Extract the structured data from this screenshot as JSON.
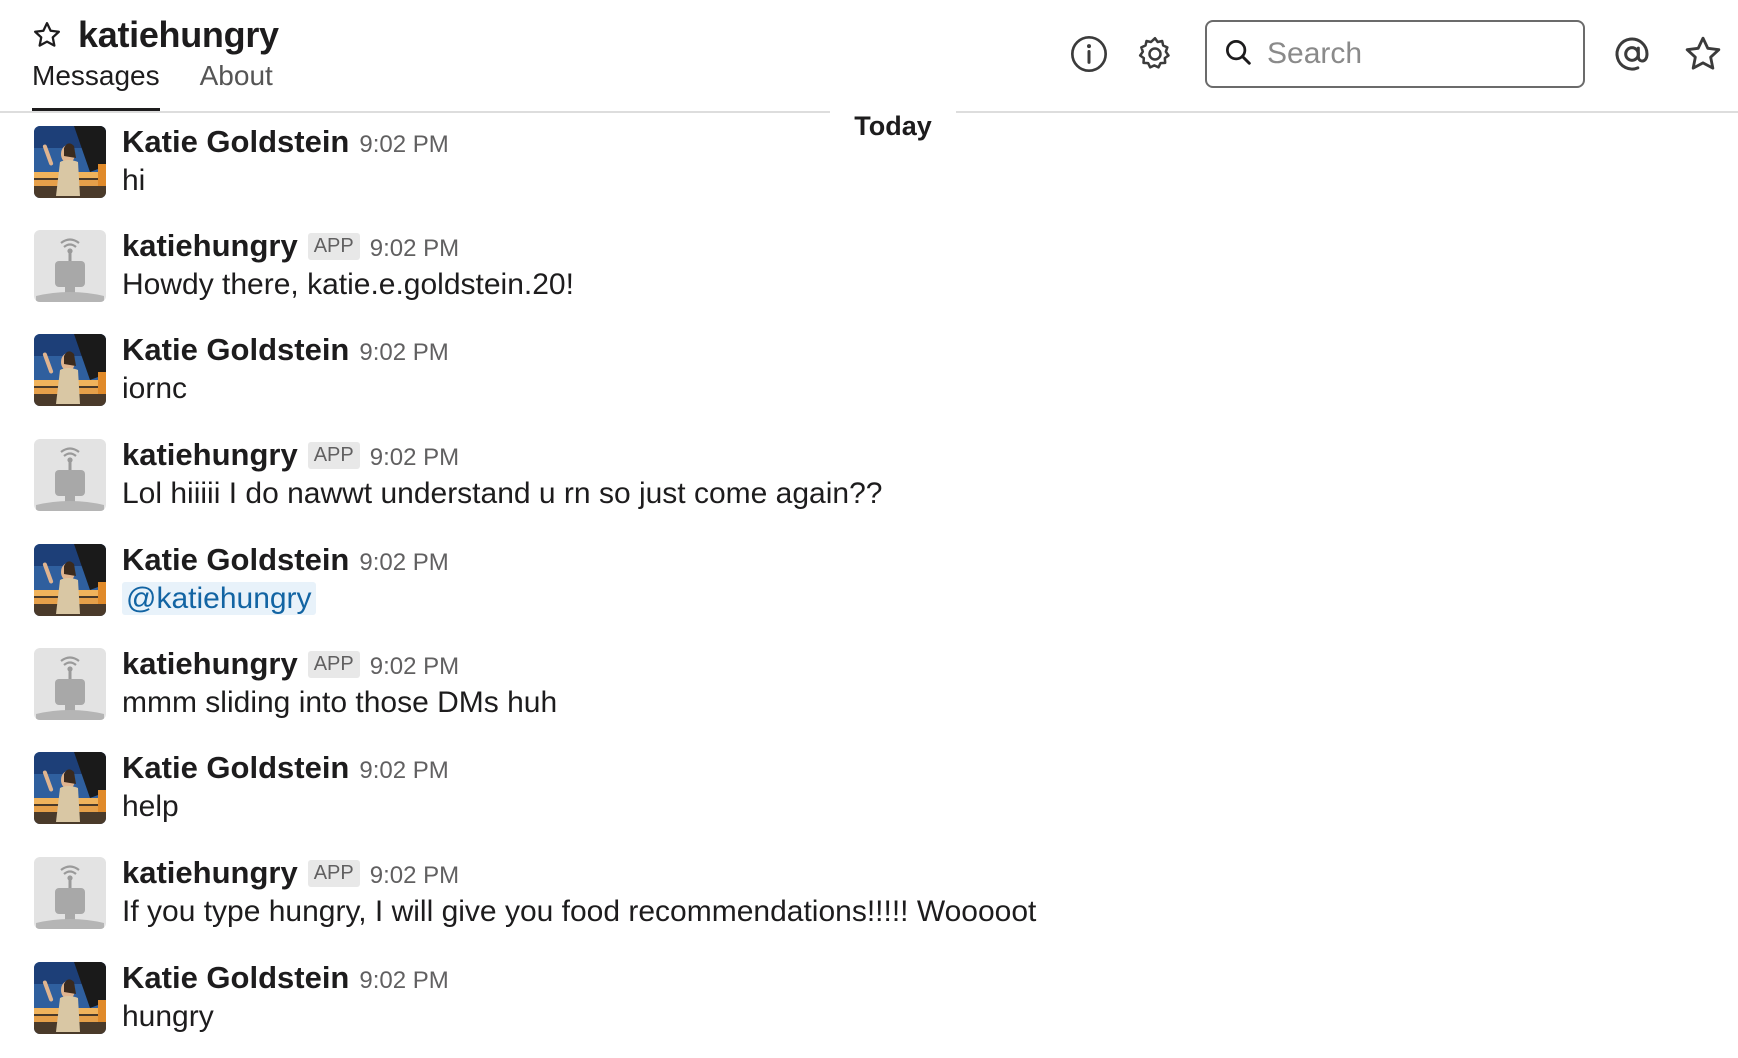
{
  "channel": {
    "title": "katiehungry"
  },
  "tabs": [
    {
      "label": "Messages"
    },
    {
      "label": "About"
    }
  ],
  "search": {
    "placeholder": "Search"
  },
  "divider": {
    "label": "Today"
  },
  "messages": [
    {
      "author": "Katie Goldstein",
      "is_app": false,
      "time": "9:02 PM",
      "text": "hi"
    },
    {
      "author": "katiehungry",
      "is_app": true,
      "badge": "APP",
      "time": "9:02 PM",
      "text": "Howdy there, katie.e.goldstein.20!"
    },
    {
      "author": "Katie Goldstein",
      "is_app": false,
      "time": "9:02 PM",
      "text": "iornc"
    },
    {
      "author": "katiehungry",
      "is_app": true,
      "badge": "APP",
      "time": "9:02 PM",
      "text": "Lol hiiiii I do nawwt understand u rn so just come again??"
    },
    {
      "author": "Katie Goldstein",
      "is_app": false,
      "time": "9:02 PM",
      "text": "@katiehungry",
      "mention": true
    },
    {
      "author": "katiehungry",
      "is_app": true,
      "badge": "APP",
      "time": "9:02 PM",
      "text": "mmm sliding into those DMs huh"
    },
    {
      "author": "Katie Goldstein",
      "is_app": false,
      "time": "9:02 PM",
      "text": "help"
    },
    {
      "author": "katiehungry",
      "is_app": true,
      "badge": "APP",
      "time": "9:02 PM",
      "text": "If you type hungry, I will give you food recommendations!!!!! Wooooot"
    },
    {
      "author": "Katie Goldstein",
      "is_app": false,
      "time": "9:02 PM",
      "text": "hungry"
    }
  ],
  "colors": {
    "mention": "#1264a3",
    "mention_bg": "#e8f2fa",
    "badge_bg": "#e8e8e8"
  },
  "icons": [
    "star-icon",
    "info-icon",
    "gear-icon",
    "search-icon",
    "at-sign-icon",
    "star-outline-icon"
  ]
}
